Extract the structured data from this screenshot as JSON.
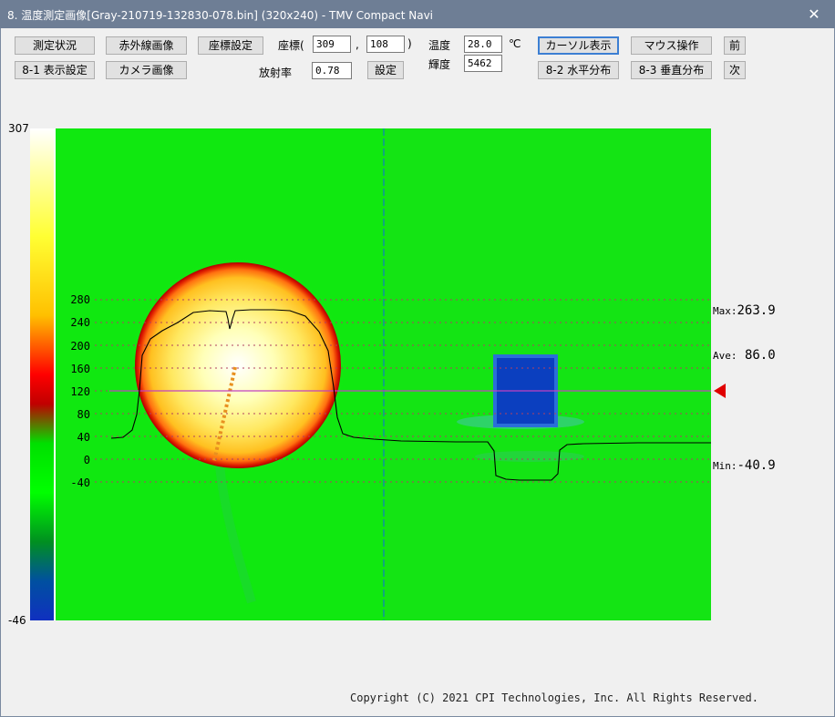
{
  "window": {
    "title": "8. 温度測定画像[Gray-210719-132830-078.bin] (320x240) - TMV Compact Navi",
    "close_glyph": "✕"
  },
  "toolbar": {
    "measure_status": "測定状況",
    "infrared_image": "赤外線画像",
    "coord_setting": "座標設定",
    "display_setting": "8-1 表示設定",
    "camera_image": "カメラ画像",
    "coord_label": "座標(",
    "coord_x": "309",
    "coord_comma": ",",
    "coord_y": "108",
    "coord_close": ")",
    "emissivity_label": "放射率",
    "emissivity_value": "0.78",
    "set_button": "設定",
    "temp_label": "温度",
    "temp_value": "28.0",
    "temp_unit": "℃",
    "brightness_label": "輝度",
    "brightness_value": "5462",
    "cursor_display": "カーソル表示",
    "mouse_operation": "マウス操作",
    "prev": "前",
    "horizontal_dist": "8-2 水平分布",
    "vertical_dist": "8-3 垂直分布",
    "next": "次"
  },
  "scale": {
    "max": "307",
    "min": "-46"
  },
  "profile_axis": {
    "ticks": [
      "280",
      "240",
      "200",
      "160",
      "120",
      "80",
      "40",
      "0",
      "-40"
    ]
  },
  "stats": {
    "max_label": "Max:",
    "max_value": "263.9",
    "ave_label": "Ave:",
    "ave_value": "86.0",
    "min_label": "Min:",
    "min_value": "-40.9"
  },
  "colors": {
    "titlebar": "#6e7e95",
    "background": "#10e810",
    "cursor_line": "#c040c0",
    "marker": "#e00000"
  },
  "footer": {
    "copyright": "Copyright (C) 2021 CPI Technologies, Inc. All Rights Reserved."
  }
}
